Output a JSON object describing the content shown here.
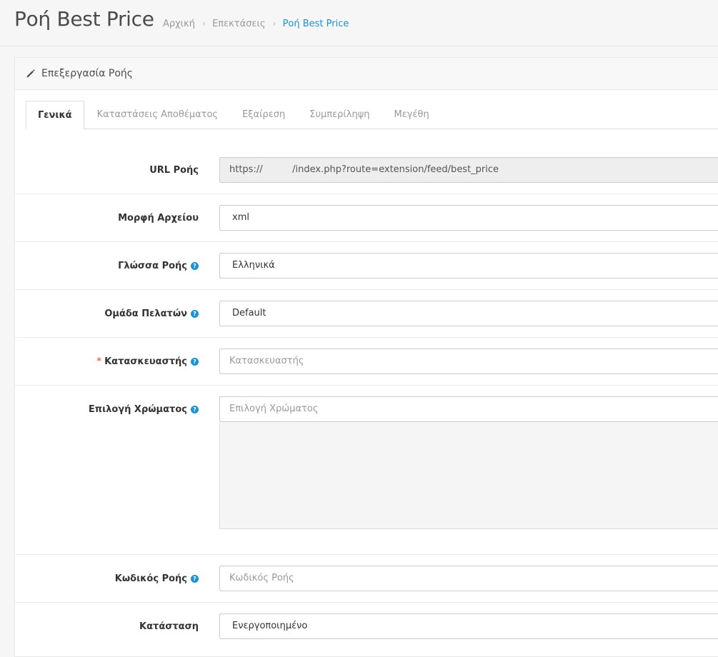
{
  "header": {
    "title": "Ροή Best Price",
    "breadcrumb": [
      "Αρχική",
      "Επεκτάσεις",
      "Ροή Best Price"
    ]
  },
  "panel": {
    "heading_icon": "pencil-icon",
    "heading": "Επεξεργασία Ροής"
  },
  "tabs": [
    {
      "label": "Γενικά",
      "active": true
    },
    {
      "label": "Καταστάσεις Αποθέματος",
      "active": false
    },
    {
      "label": "Εξαίρεση",
      "active": false
    },
    {
      "label": "Συμπερίληψη",
      "active": false
    },
    {
      "label": "Μεγέθη",
      "active": false
    }
  ],
  "form": {
    "feed_url": {
      "label": "URL Ροής",
      "scheme": "https://",
      "path": "/index.php?route=extension/feed/best_price"
    },
    "file_format": {
      "label": "Μορφή Αρχείου",
      "value": "xml"
    },
    "language": {
      "label": "Γλώσσα Ροής",
      "value": "Ελληνικά"
    },
    "customer_group": {
      "label": "Ομάδα Πελατών",
      "value": "Default"
    },
    "manufacturer": {
      "label": "Κατασκευαστής",
      "placeholder": "Κατασκευαστής",
      "required_mark": "*"
    },
    "color": {
      "label": "Επιλογή Χρώματος",
      "placeholder": "Επιλογή Χρώματος"
    },
    "feed_code": {
      "label": "Κωδικός Ροής",
      "placeholder": "Κωδικός Ροής"
    },
    "status": {
      "label": "Κατάσταση",
      "value": "Ενεργοποιημένο"
    }
  },
  "help_icon": "?",
  "colors": {
    "accent": "#1e91cf",
    "required": "#f56b6b"
  }
}
